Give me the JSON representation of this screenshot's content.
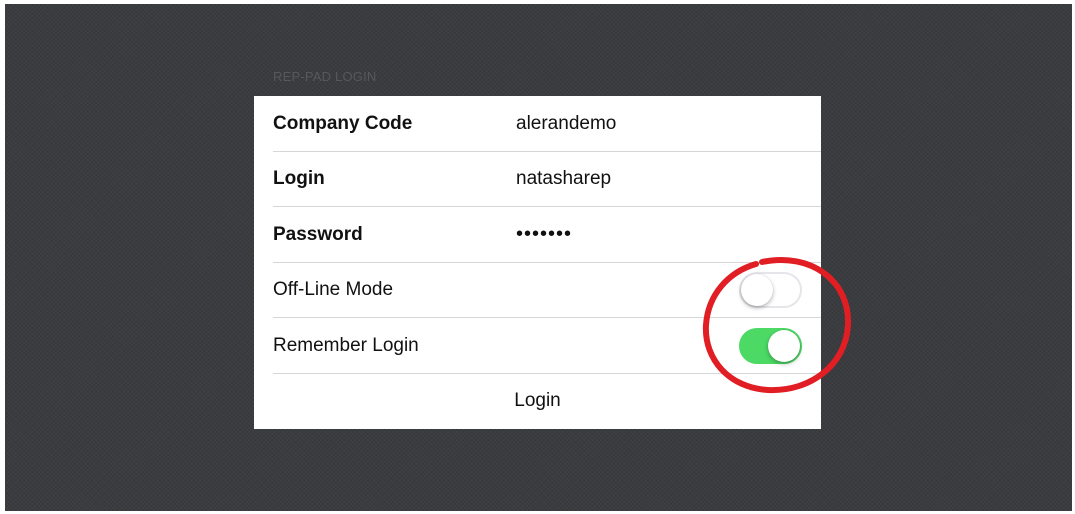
{
  "section_header": "REP-PAD LOGIN",
  "form": {
    "company_code": {
      "label": "Company Code",
      "value": "alerandemo"
    },
    "login": {
      "label": "Login",
      "value": "natasharep"
    },
    "password": {
      "label": "Password",
      "value": "•••••••"
    },
    "offline_mode": {
      "label": "Off-Line Mode",
      "enabled": false
    },
    "remember_login": {
      "label": "Remember Login",
      "enabled": true
    },
    "login_button": "Login"
  },
  "colors": {
    "toggle_on": "#4cd964",
    "annotation": "#e01e24",
    "background": "#3a3c3f"
  }
}
